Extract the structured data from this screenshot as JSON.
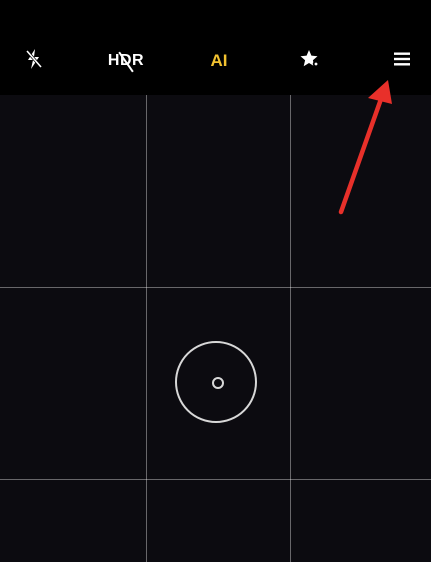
{
  "topbar": {
    "flash": {
      "icon": "flash-off-icon"
    },
    "hdr": {
      "label": "HDR",
      "icon": "hdr-off-icon",
      "state": "off"
    },
    "ai": {
      "label": "AI",
      "color": "#f2c230"
    },
    "beauty": {
      "icon": "beauty-mode-icon"
    },
    "menu": {
      "icon": "hamburger-menu-icon"
    }
  },
  "viewfinder": {
    "grid": "3x3",
    "focus_indicator": "focus-ring-icon"
  },
  "annotation": {
    "color": "#e8302a",
    "points_to": "menu"
  }
}
